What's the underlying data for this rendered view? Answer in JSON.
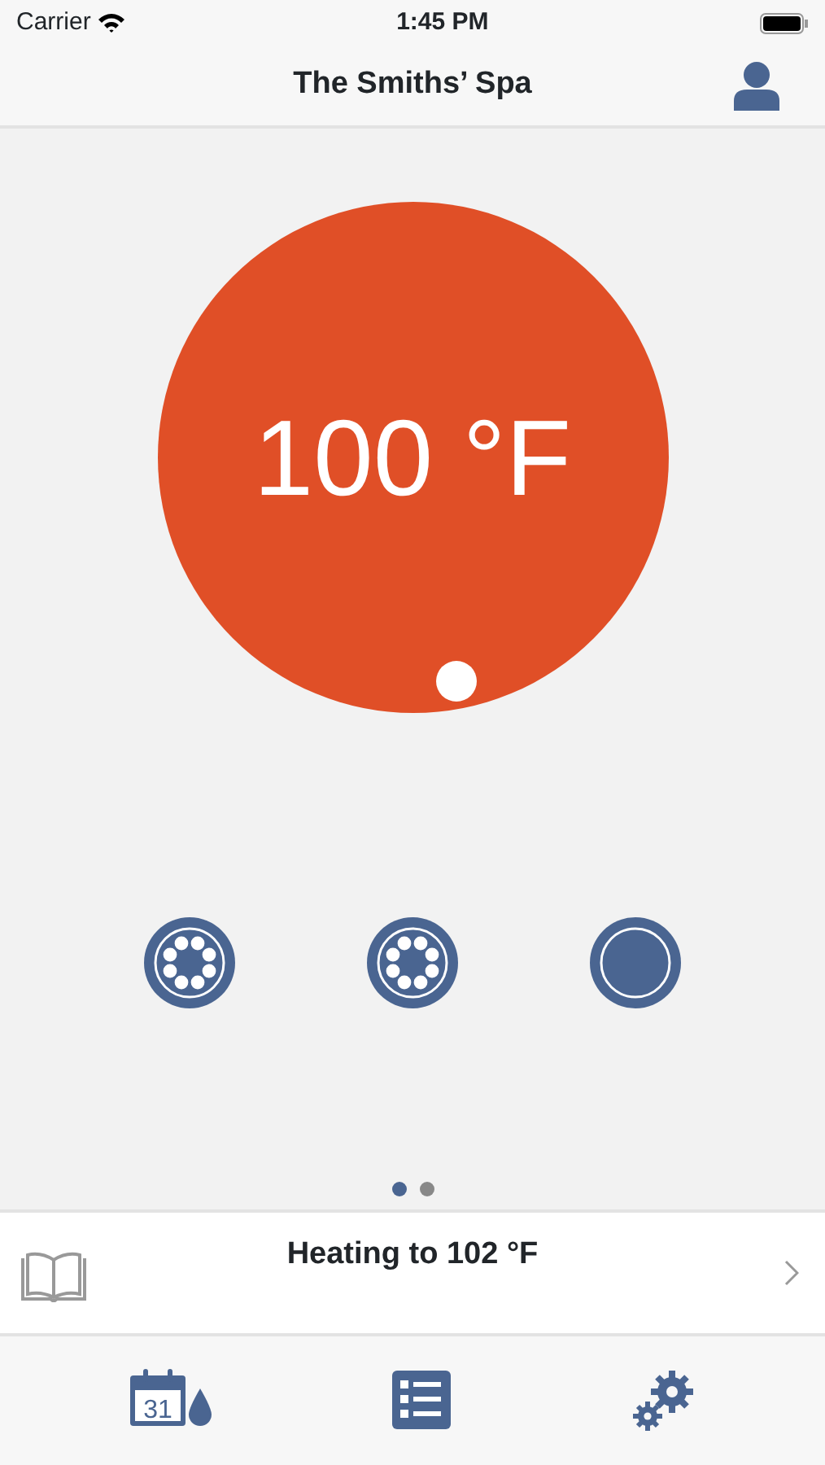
{
  "status_bar": {
    "carrier": "Carrier",
    "time": "1:45 PM"
  },
  "nav": {
    "title": "The Smiths’ Spa"
  },
  "temperature": {
    "reading": "100 °F"
  },
  "pumps": [
    {
      "on": true
    },
    {
      "on": true
    },
    {
      "on": false
    }
  ],
  "pages": [
    {
      "selected": true
    },
    {
      "selected": false
    }
  ],
  "status": {
    "text": "Heating to 102 °F"
  },
  "tab_bar": {
    "calendar_day": "31"
  }
}
